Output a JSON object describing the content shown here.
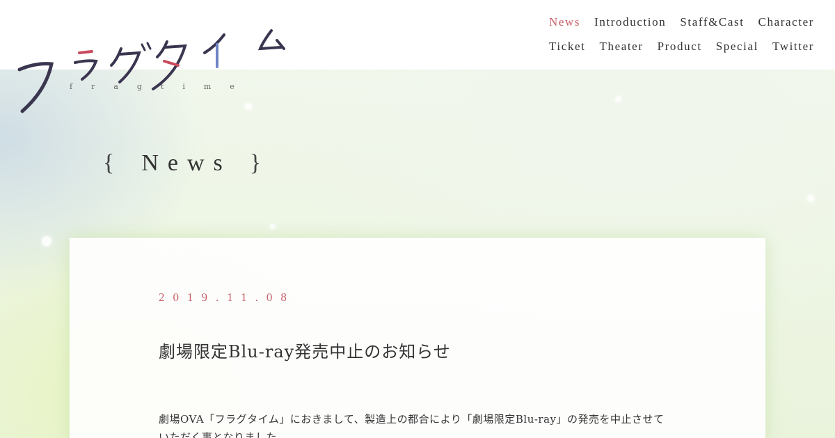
{
  "site": {
    "logo_text": "フラグタイム",
    "logo_subtext": "fragtime"
  },
  "nav": {
    "row1": [
      {
        "label": "News",
        "active": true
      },
      {
        "label": "Introduction",
        "active": false
      },
      {
        "label": "Staff&Cast",
        "active": false
      },
      {
        "label": "Character",
        "active": false
      }
    ],
    "row2": [
      {
        "label": "Ticket",
        "active": false
      },
      {
        "label": "Theater",
        "active": false
      },
      {
        "label": "Product",
        "active": false
      },
      {
        "label": "Special",
        "active": false
      },
      {
        "label": "Twitter",
        "active": false
      }
    ]
  },
  "section": {
    "brace_open": "{",
    "title": "News",
    "brace_close": "}"
  },
  "post": {
    "date": "2019.11.08",
    "title": "劇場限定Blu-ray発売中止のお知らせ",
    "body": "劇場OVA「フラグタイム」におきまして、製造上の都合により「劇場限定Blu-ray」の発売を中止させていただく事となりました。"
  },
  "colors": {
    "accent": "#c9606a",
    "text": "#333333",
    "header_bg": "#ffffff"
  }
}
